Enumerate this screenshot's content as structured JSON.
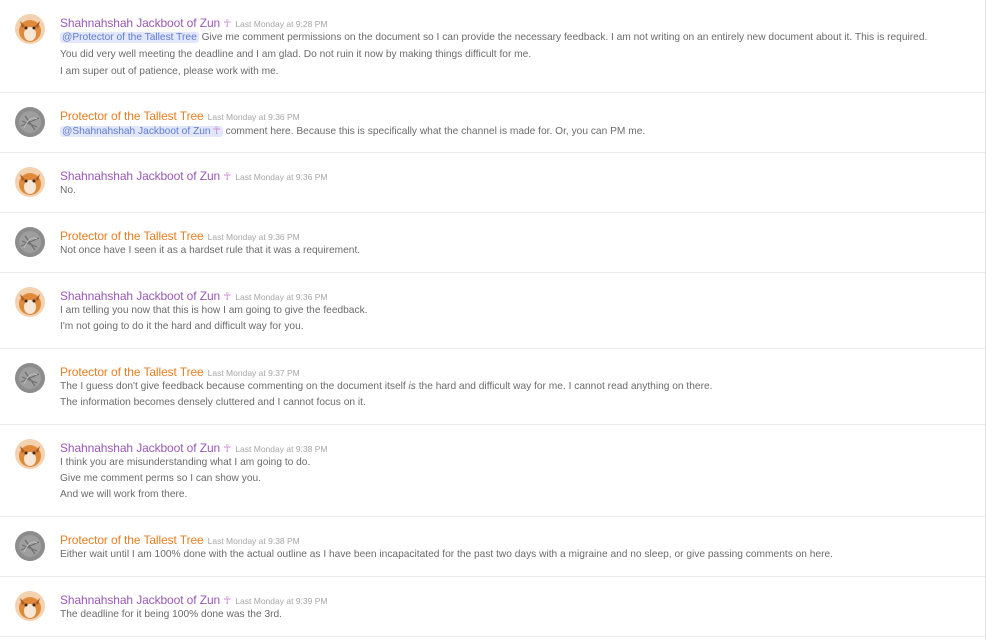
{
  "users": {
    "shah": "Shahnahshah Jackboot of Zun",
    "prot": "Protector of the Tallest Tree"
  },
  "role_glyph": "☥",
  "messages": [
    {
      "author": "Shahnahshah Jackboot of Zun",
      "timestamp": "Last Monday at 9:28 PM",
      "mention": "@Protector of the Tallest Tree",
      "lines": [
        "Give me comment permissions on the document so I can provide the necessary feedback. I am not writing on an entirely new document about it. This is required.",
        "You did very well meeting the deadline and I am glad. Do not ruin it now by making things difficult for me.",
        "I am super out of patience, please work with me."
      ]
    },
    {
      "author": "Protector of the Tallest Tree",
      "timestamp": "Last Monday at 9:36 PM",
      "mention": "@Shahnahshah Jackboot of Zun",
      "lines": [
        "comment here. Because this is specifically what the channel is made for. Or, you can PM me."
      ]
    },
    {
      "author": "Shahnahshah Jackboot of Zun",
      "timestamp": "Last Monday at 9:36 PM",
      "lines": [
        "No."
      ]
    },
    {
      "author": "Protector of the Tallest Tree",
      "timestamp": "Last Monday at 9:36 PM",
      "lines": [
        "Not once have I seen it as a hardset rule that it was a requirement."
      ]
    },
    {
      "author": "Shahnahshah Jackboot of Zun",
      "timestamp": "Last Monday at 9:36 PM",
      "lines": [
        "I am telling you now that this is how I am going to give the feedback.",
        "I'm not going to do it the hard and difficult way for you."
      ]
    },
    {
      "author": "Protector of the Tallest Tree",
      "timestamp": "Last Monday at 9:37 PM",
      "lines_rich": [
        {
          "before": "The I guess don't give feedback because commenting on the document itself ",
          "em": "is",
          "after": " the hard and difficult way for me. I cannot read anything on there."
        }
      ],
      "lines": [
        "The information becomes densely cluttered and I cannot focus on it."
      ]
    },
    {
      "author": "Shahnahshah Jackboot of Zun",
      "timestamp": "Last Monday at 9:38 PM",
      "lines": [
        "I think you are misunderstanding what I am going to do.",
        "Give me comment perms so I can show you.",
        "And we will work from there."
      ]
    },
    {
      "author": "Protector of the Tallest Tree",
      "timestamp": "Last Monday at 9:38 PM",
      "lines": [
        "Either wait until I am 100% done with the actual outline as I have been incapacitated for the past two days with a migraine and no sleep, or give passing comments on here."
      ]
    },
    {
      "author": "Shahnahshah Jackboot of Zun",
      "timestamp": "Last Monday at 9:39 PM",
      "lines": [
        "The deadline for it being 100% done was the 3rd."
      ]
    }
  ],
  "colors": {
    "shah_name": "#9b59b6",
    "prot_name": "#e67e22",
    "mention_bg": "#e3e7fb",
    "mention_text": "#5f7ccf"
  }
}
